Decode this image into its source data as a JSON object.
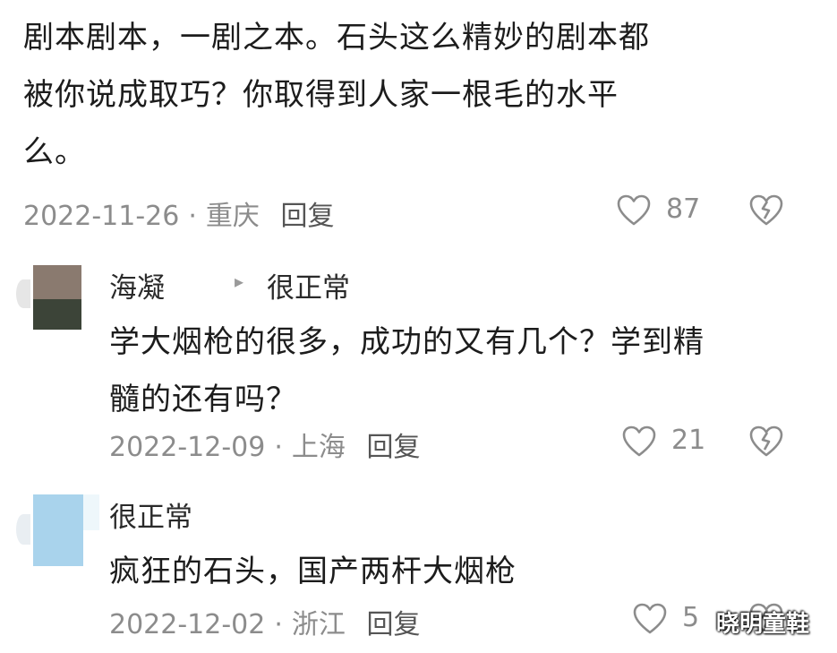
{
  "top_comment": {
    "text_lines": [
      "剧本剧本，一剧之本。石头这么精妙的剧本都",
      "被你说成取巧？你取得到人家一根毛的水平",
      "么。"
    ],
    "date": "2022-11-26",
    "location": "重庆",
    "reply_label": "回复",
    "likes": "87",
    "like_icon": "heart-outline-icon",
    "dislike_icon": "broken-heart-icon"
  },
  "reply_1": {
    "author": "海凝",
    "arrow": "▸",
    "reply_to": "很正常",
    "text_lines": [
      "学大烟枪的很多，成功的又有几个？学到精",
      "髓的还有吗？"
    ],
    "date": "2022-12-09",
    "location": "上海",
    "reply_label": "回复",
    "likes": "21"
  },
  "reply_2": {
    "author": "很正常",
    "text_lines": [
      "疯狂的石头，国产两杆大烟枪"
    ],
    "date": "2022-12-02",
    "location": "浙江",
    "reply_label": "回复",
    "likes": "5"
  },
  "watermark": "晓明童鞋"
}
